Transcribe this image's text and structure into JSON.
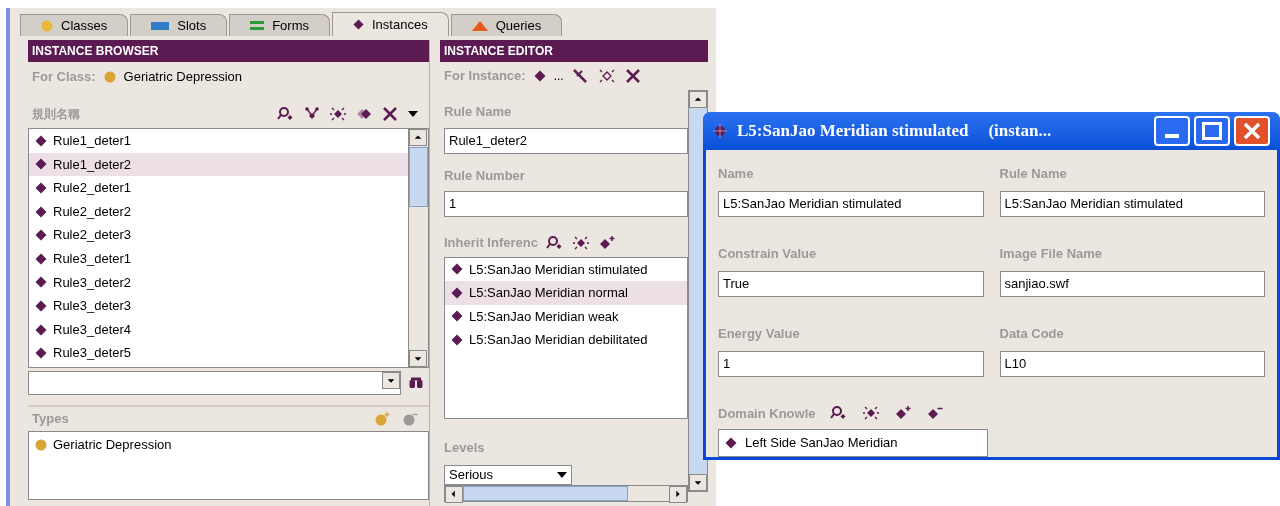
{
  "tabs": [
    {
      "label": "Classes",
      "selected": false
    },
    {
      "label": "Slots",
      "selected": false
    },
    {
      "label": "Forms",
      "selected": false
    },
    {
      "label": "Instances",
      "selected": true
    },
    {
      "label": "Queries",
      "selected": false
    }
  ],
  "instance_browser": {
    "title": "INSTANCE BROWSER",
    "for_class_label": "For Class:",
    "for_class_value": "Geriatric Depression",
    "list_header": "規則名稱",
    "instances": [
      {
        "label": "Rule1_deter1",
        "selected": false
      },
      {
        "label": "Rule1_deter2",
        "selected": true
      },
      {
        "label": "Rule2_deter1",
        "selected": false
      },
      {
        "label": "Rule2_deter2",
        "selected": false
      },
      {
        "label": "Rule2_deter3",
        "selected": false
      },
      {
        "label": "Rule3_deter1",
        "selected": false
      },
      {
        "label": "Rule3_deter2",
        "selected": false
      },
      {
        "label": "Rule3_deter3",
        "selected": false
      },
      {
        "label": "Rule3_deter4",
        "selected": false
      },
      {
        "label": "Rule3_deter5",
        "selected": false
      }
    ],
    "types_label": "Types",
    "types": [
      "Geriatric Depression"
    ]
  },
  "instance_editor": {
    "title": "INSTANCE EDITOR",
    "for_instance_label": "For Instance:",
    "for_instance_value": "...",
    "fields": [
      {
        "label": "Rule Name",
        "value": "Rule1_deter2"
      },
      {
        "label": "Rule Number",
        "value": "1"
      }
    ],
    "inherit_label": "Inherit Inferenc",
    "inherit_items": [
      {
        "label": "L5:SanJao Meridian stimulated",
        "selected": false
      },
      {
        "label": "L5:SanJao Meridian normal",
        "selected": true
      },
      {
        "label": "L5:SanJao Meridian weak",
        "selected": false
      },
      {
        "label": "L5:SanJao Meridian debilitated",
        "selected": false
      }
    ],
    "levels_label": "Levels",
    "levels_value": "Serious"
  },
  "dialog": {
    "title": "L5:SanJao Meridian stimulated",
    "title_suffix": "(instan...",
    "fields": [
      {
        "label": "Name",
        "value": "L5:SanJao Meridian stimulated"
      },
      {
        "label": "Rule Name",
        "value": "L5:SanJao Meridian stimulated"
      },
      {
        "label": "Constrain Value",
        "value": "True"
      },
      {
        "label": "Image File Name",
        "value": "sanjiao.swf"
      },
      {
        "label": "Energy Value",
        "value": "1"
      },
      {
        "label": "Data Code",
        "value": "L10"
      }
    ],
    "domain_label": "Domain Knowle",
    "domain_items": [
      "Left Side SanJao Meridian"
    ]
  }
}
